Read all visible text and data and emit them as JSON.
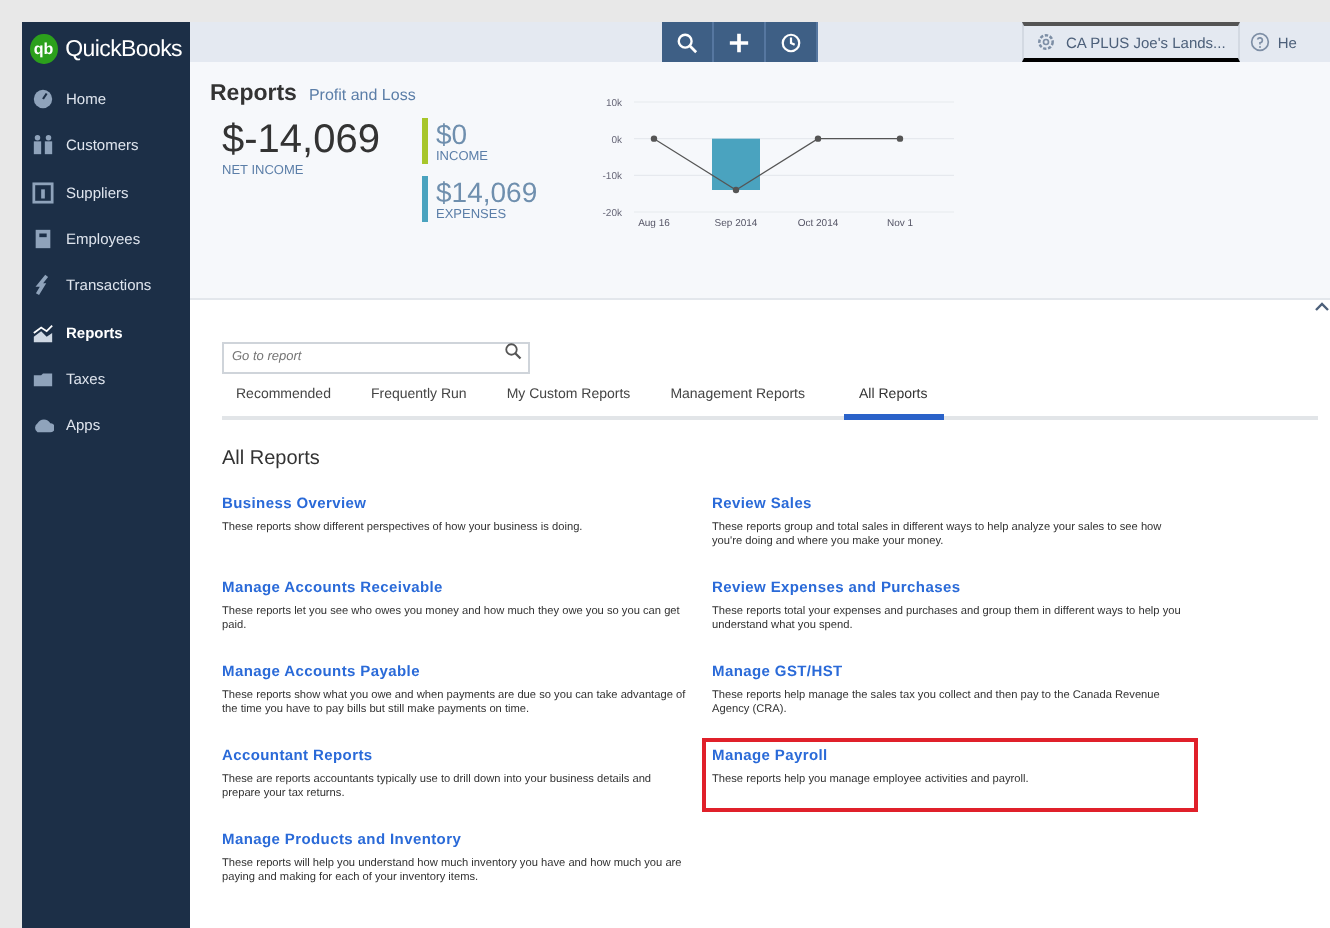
{
  "sidebar": {
    "logo_mark": "qb",
    "logo": "QuickBooks",
    "items": [
      {
        "label": "Home",
        "selected": false
      },
      {
        "label": "Customers",
        "selected": false
      },
      {
        "label": "Suppliers",
        "selected": false
      },
      {
        "label": "Employees",
        "selected": false
      },
      {
        "label": "Transactions",
        "selected": false
      },
      {
        "label": "Reports",
        "selected": true
      },
      {
        "label": "Taxes",
        "selected": false
      },
      {
        "label": "Apps",
        "selected": false
      }
    ]
  },
  "top_bar": {
    "company": "CA PLUS Joe's Lands...",
    "help": "He"
  },
  "header": {
    "title": "Reports",
    "subtitle": "Profit and Loss",
    "net_income": {
      "value": "$-14,069",
      "label": "NET INCOME"
    },
    "income": {
      "value": "$0",
      "label": "INCOME"
    },
    "expenses": {
      "value": "$14,069",
      "label": "EXPENSES"
    },
    "chart_data": {
      "type": "line",
      "categories": [
        "Aug 16",
        "Sep 2014",
        "Oct 2014",
        "Nov 1"
      ],
      "series": [
        {
          "color": "#555555",
          "marker": true,
          "values": [
            0,
            -14000,
            0,
            0
          ]
        }
      ],
      "ylim": [
        -20000,
        10000
      ],
      "yticks": [
        {
          "value": 10000,
          "label": "10k"
        },
        {
          "value": 0,
          "label": "0k"
        },
        {
          "value": -10000,
          "label": "-10k"
        },
        {
          "value": -20000,
          "label": "-20k"
        }
      ]
    }
  },
  "search": {
    "placeholder": "Go to report"
  },
  "tabs": [
    {
      "label": "Recommended",
      "selected": false
    },
    {
      "label": "Frequently Run",
      "selected": false
    },
    {
      "label": "My Custom Reports",
      "selected": false
    },
    {
      "label": "Management Reports",
      "selected": false
    },
    {
      "label": "All Reports",
      "selected": true
    }
  ],
  "section_title": "All Reports",
  "reports": [
    {
      "title": "Business Overview",
      "description": "These reports show different perspectives of how your business is doing.",
      "highlighted": false
    },
    {
      "title": "Review Sales",
      "description": "These reports group and total sales in different ways to help analyze your sales to see how you're doing and where you make your money.",
      "highlighted": false
    },
    {
      "title": "Manage Accounts Receivable",
      "description": "These reports let you see who owes you money and how much they owe you so you can get paid.",
      "highlighted": false
    },
    {
      "title": "Review Expenses and Purchases",
      "description": "These reports total your expenses and purchases and group them in different ways to help you understand what you spend.",
      "highlighted": false
    },
    {
      "title": "Manage Accounts Payable",
      "description": "These reports show what you owe and when payments are due so you can take advantage of the time you have to pay bills but still make payments on time.",
      "highlighted": false
    },
    {
      "title": "Manage GST/HST",
      "description": "These reports help manage the sales tax you collect and then pay to the Canada Revenue Agency (CRA).",
      "highlighted": false
    },
    {
      "title": "Accountant Reports",
      "description": "These are reports accountants typically use to drill down into your business details and prepare your tax returns.",
      "highlighted": false
    },
    {
      "title": "Manage Payroll",
      "description": "These reports help you manage employee activities and payroll.",
      "highlighted": true
    },
    {
      "title": "Manage Products and Inventory",
      "description": "These reports will help you understand how much inventory you have and how much you are paying and making for each of your inventory items.",
      "highlighted": false
    }
  ]
}
